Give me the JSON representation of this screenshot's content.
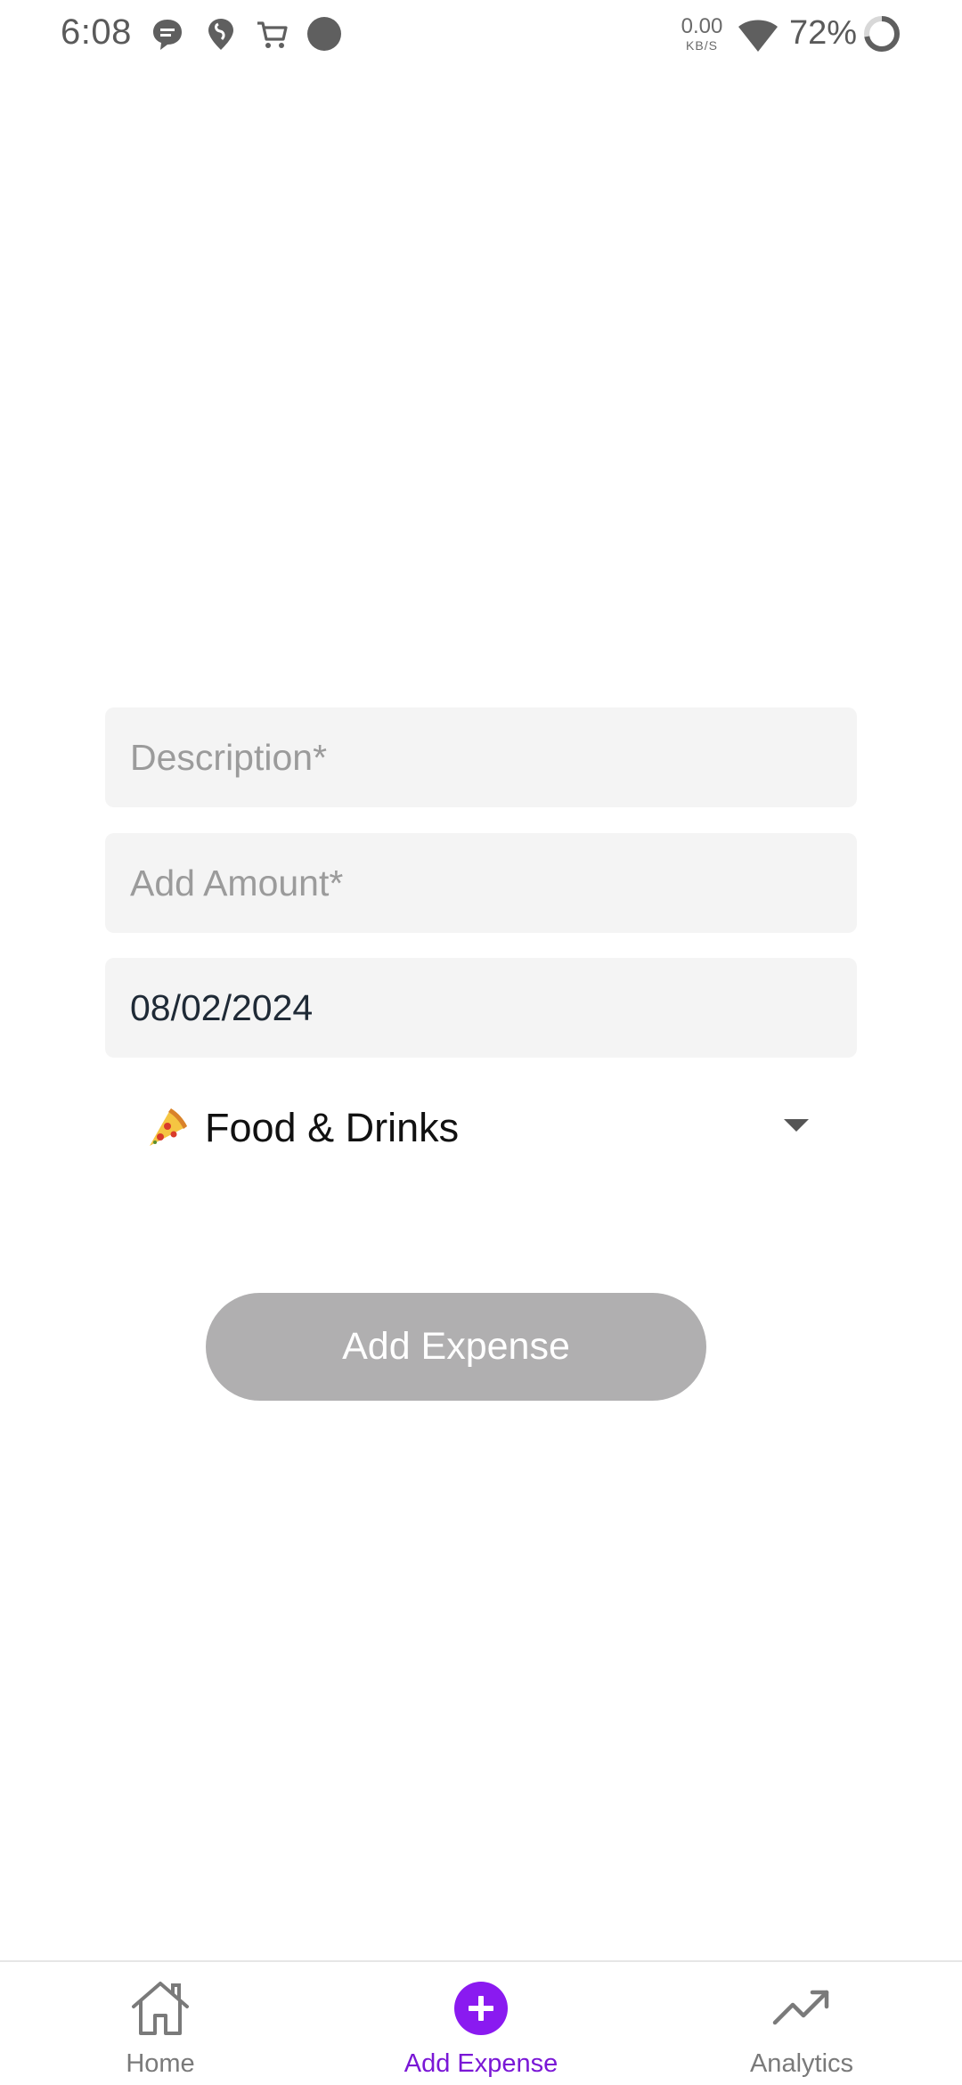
{
  "status_bar": {
    "time": "6:08",
    "net_speed_value": "0.00",
    "net_speed_unit": "KB/S",
    "battery": "72%",
    "icons": [
      "chat-bubble-icon",
      "swiggy-icon",
      "cart-icon",
      "dot-icon",
      "wifi-icon",
      "battery-ring-icon"
    ]
  },
  "form": {
    "description_placeholder": "Description*",
    "description_value": "",
    "amount_placeholder": "Add Amount*",
    "amount_value": "",
    "date_value": "08/02/2024",
    "category": {
      "icon": "pizza-icon",
      "label": "Food & Drinks"
    },
    "submit_label": "Add Expense",
    "submit_color": "#b0afb0"
  },
  "bottom_nav": {
    "active_color": "#7a17d6",
    "items": [
      {
        "label": "Home",
        "icon": "home-icon"
      },
      {
        "label": "Add Expense",
        "icon": "add-circle-icon"
      },
      {
        "label": "Analytics",
        "icon": "trending-up-icon"
      }
    ]
  }
}
